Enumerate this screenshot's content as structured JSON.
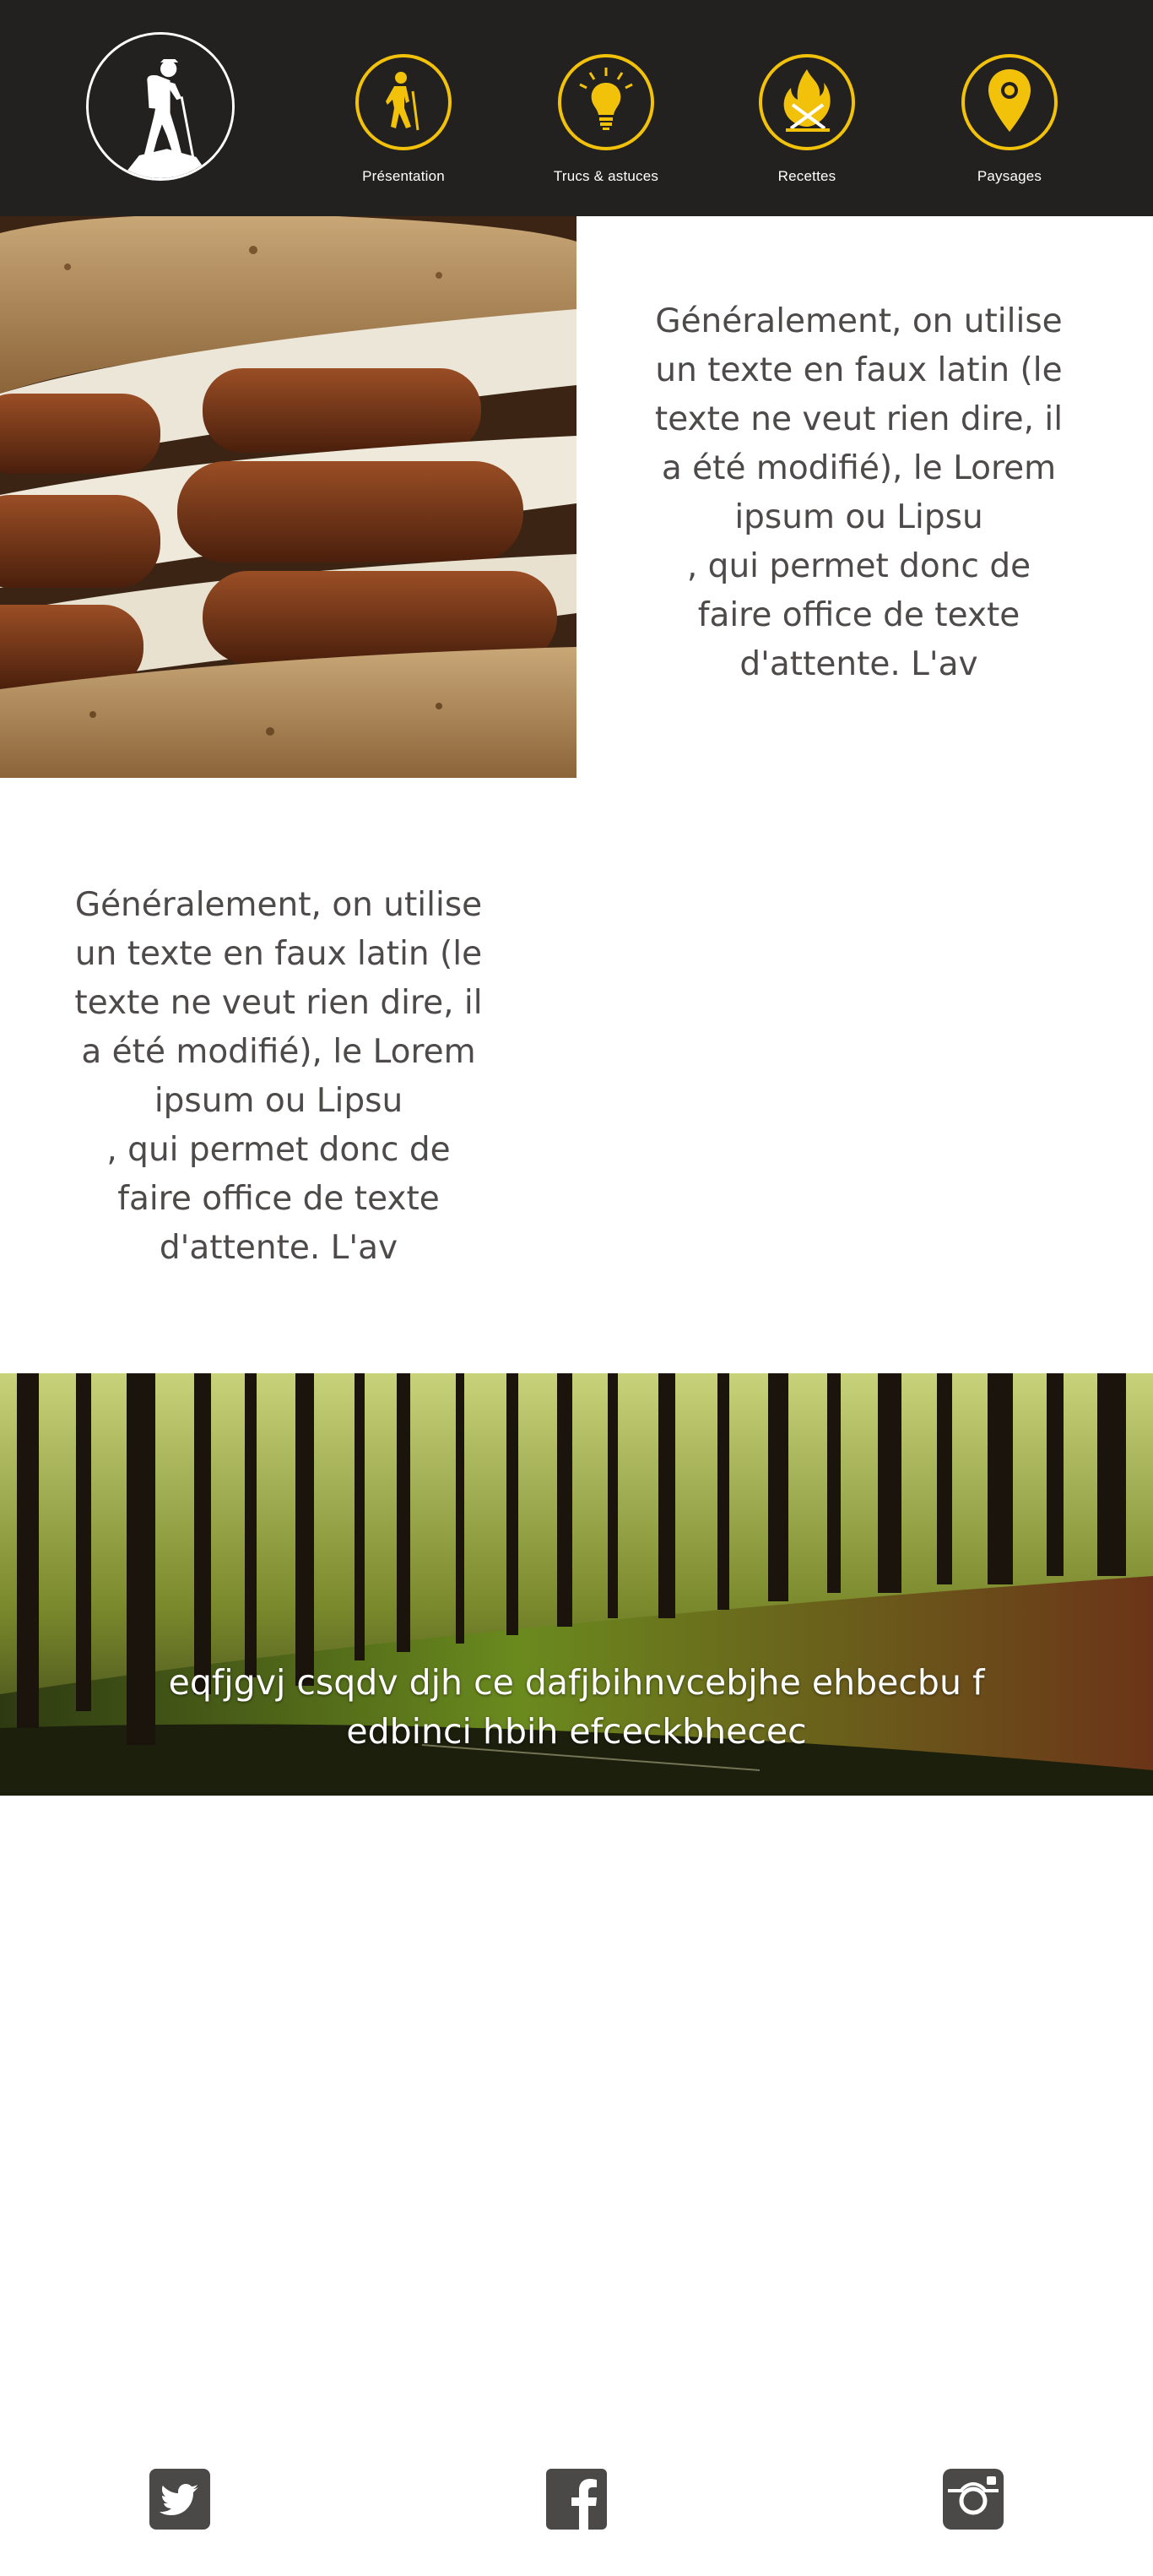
{
  "colors": {
    "header_background": "#232120",
    "accent": "#f2c20a",
    "body_text": "#4d4a49",
    "social_icon": "#4a4948"
  },
  "header": {
    "logo_icon": "hiker-icon",
    "nav": [
      {
        "label": "Présentation",
        "icon": "hiker-walking-icon"
      },
      {
        "label": "Trucs & astuces",
        "icon": "lightbulb-icon"
      },
      {
        "label": "Recettes",
        "icon": "campfire-utensils-icon"
      },
      {
        "label": "Paysages",
        "icon": "map-pin-icon"
      }
    ]
  },
  "section_one": {
    "image": "sausage-sandwich-photo",
    "text": "Généralement, on utilise\nun texte en faux latin (le\ntexte ne veut rien dire, il\na été modifié), le Lorem\nipsum ou Lipsu\n, qui permet donc de\nfaire office de texte\nd'attente. L'av"
  },
  "section_two": {
    "text": "Généralement, on utilise\nun texte en faux latin (le\ntexte ne veut rien dire, il\na été modifié), le Lorem\nipsum ou Lipsu\n, qui permet donc de\nfaire office de texte\nd'attente. L'av"
  },
  "banner": {
    "image": "forest-photo",
    "caption": "eqfjgvj csqdv djh ce dafjbihnvcebjhe ehbecbu f\nedbinci hbih efceckbhecec"
  },
  "footer": {
    "social": [
      {
        "icon": "twitter-icon"
      },
      {
        "icon": "facebook-icon"
      },
      {
        "icon": "instagram-icon"
      }
    ]
  }
}
